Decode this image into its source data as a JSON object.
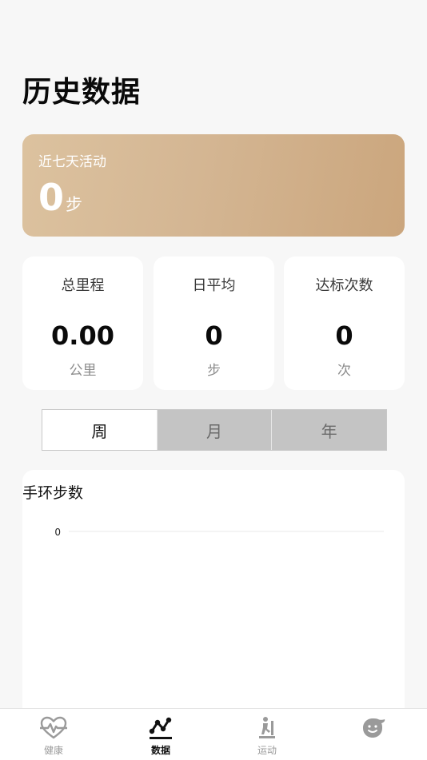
{
  "page": {
    "title": "历史数据"
  },
  "activity": {
    "label": "近七天活动",
    "value": "0",
    "unit": "步"
  },
  "stats": [
    {
      "title": "总里程",
      "value": "0.00",
      "unit": "公里"
    },
    {
      "title": "日平均",
      "value": "0",
      "unit": "步"
    },
    {
      "title": "达标次数",
      "value": "0",
      "unit": "次"
    }
  ],
  "period_tabs": [
    {
      "label": "周",
      "selected": true
    },
    {
      "label": "月",
      "selected": false
    },
    {
      "label": "年",
      "selected": false
    }
  ],
  "chart": {
    "title": "手环步数"
  },
  "chart_data": {
    "type": "bar",
    "title": "手环步数",
    "categories": [],
    "values": [],
    "yticks": [
      "0"
    ],
    "ylim": [
      0,
      0
    ],
    "grid": true
  },
  "tabbar": {
    "items": [
      {
        "label": "健康",
        "icon": "heart-pulse-icon",
        "active": false
      },
      {
        "label": "数据",
        "icon": "data-trend-icon",
        "active": true
      },
      {
        "label": "运动",
        "icon": "treadmill-icon",
        "active": false
      },
      {
        "label": "",
        "icon": "face-icon",
        "active": false
      }
    ]
  },
  "colors": {
    "card_gradient_start": "#dcc29f",
    "card_gradient_end": "#cba67d",
    "segment_inactive": "#c4c4c4",
    "background": "#f7f7f7"
  }
}
